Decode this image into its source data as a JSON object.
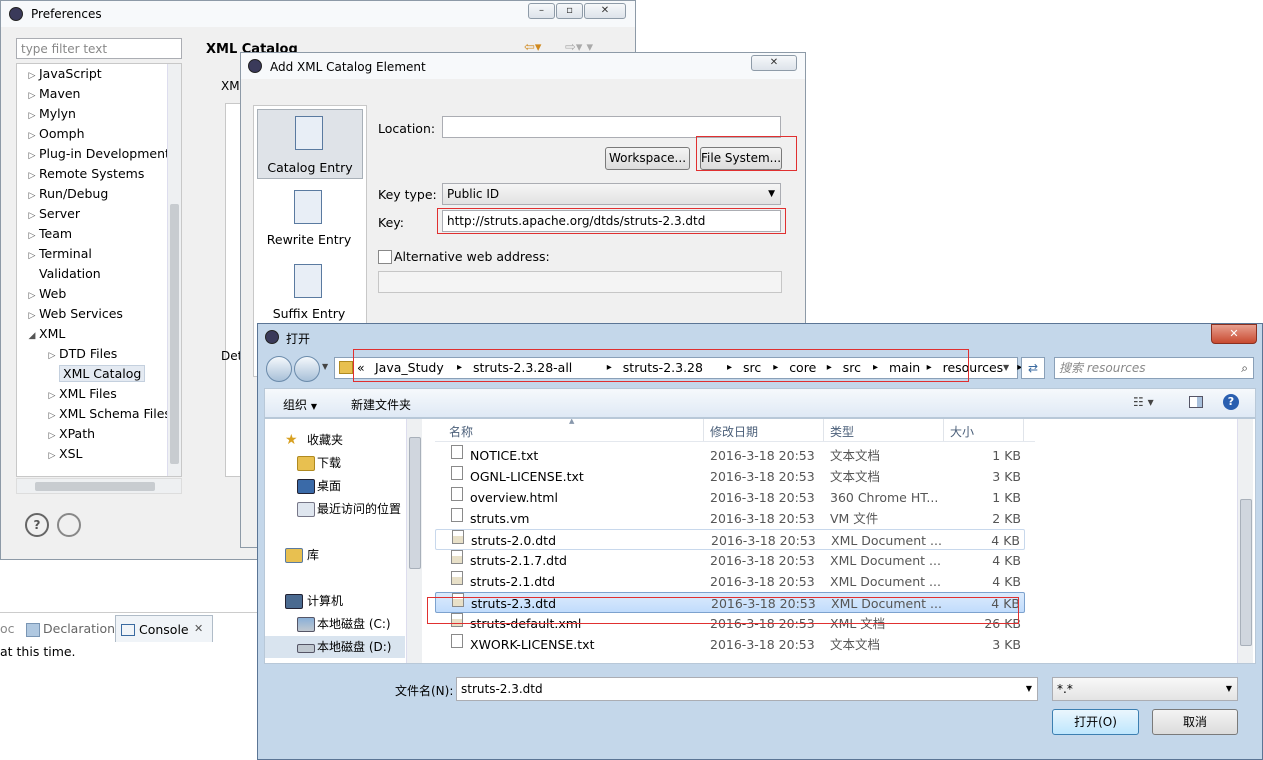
{
  "preferences": {
    "title": "Preferences",
    "filter_placeholder": "type filter text",
    "header_title": "XML Catalog",
    "partial_xm": "XM",
    "partial_det": "Det",
    "tree": [
      {
        "label": "JavaScript",
        "arrow": "▷"
      },
      {
        "label": "Maven",
        "arrow": "▷"
      },
      {
        "label": "Mylyn",
        "arrow": "▷"
      },
      {
        "label": "Oomph",
        "arrow": "▷"
      },
      {
        "label": "Plug-in Development",
        "arrow": "▷"
      },
      {
        "label": "Remote Systems",
        "arrow": "▷"
      },
      {
        "label": "Run/Debug",
        "arrow": "▷"
      },
      {
        "label": "Server",
        "arrow": "▷"
      },
      {
        "label": "Team",
        "arrow": "▷"
      },
      {
        "label": "Terminal",
        "arrow": "▷"
      },
      {
        "label": "Validation",
        "arrow": ""
      },
      {
        "label": "Web",
        "arrow": "▷"
      },
      {
        "label": "Web Services",
        "arrow": "▷"
      },
      {
        "label": "XML",
        "arrow": "◢"
      },
      {
        "label": "DTD Files",
        "arrow": "▷"
      },
      {
        "label": "XML Catalog",
        "arrow": ""
      },
      {
        "label": "XML Files",
        "arrow": "▷"
      },
      {
        "label": "XML Schema Files",
        "arrow": "▷"
      },
      {
        "label": "XPath",
        "arrow": "▷"
      },
      {
        "label": "XSL",
        "arrow": "▷"
      }
    ]
  },
  "console_bar": {
    "partial_left": "oc",
    "declaration_tab": "Declaration",
    "console_tab": "Console",
    "status_text": "at this time."
  },
  "catalog_dialog": {
    "title": "Add XML Catalog Element",
    "side_items": [
      "Catalog Entry",
      "Rewrite Entry",
      "Suffix Entry"
    ],
    "location_label": "Location:",
    "location_value": "",
    "workspace_button": "Workspace...",
    "filesystem_button": "File System...",
    "keytype_label": "Key type:",
    "keytype_value": "Public ID",
    "key_label": "Key:",
    "key_value": "http://struts.apache.org/dtds/struts-2.3.dtd",
    "alt_web_label": "Alternative web address:",
    "alt_web_value": ""
  },
  "open_dialog": {
    "title": "打开",
    "breadcrumb": [
      "«",
      "Java_Study",
      "struts-2.3.28-all",
      "struts-2.3.28",
      "src",
      "core",
      "src",
      "main",
      "resources"
    ],
    "search_placeholder": "搜索 resources",
    "organize": "组织",
    "new_folder": "新建文件夹",
    "nav": {
      "favorites": "收藏夹",
      "downloads": "下载",
      "desktop": "桌面",
      "recent": "最近访问的位置",
      "libraries": "库",
      "computer": "计算机",
      "drive_c": "本地磁盘 (C:)",
      "drive_d": "本地磁盘 (D:)"
    },
    "columns": {
      "name": "名称",
      "date": "修改日期",
      "type": "类型",
      "size": "大小"
    },
    "files": [
      {
        "name": "NOTICE.txt",
        "date": "2016-3-18 20:53",
        "type": "文本文档",
        "size": "1 KB",
        "kind": "txt"
      },
      {
        "name": "OGNL-LICENSE.txt",
        "date": "2016-3-18 20:53",
        "type": "文本文档",
        "size": "3 KB",
        "kind": "txt"
      },
      {
        "name": "overview.html",
        "date": "2016-3-18 20:53",
        "type": "360 Chrome HT...",
        "size": "1 KB",
        "kind": "txt"
      },
      {
        "name": "struts.vm",
        "date": "2016-3-18 20:53",
        "type": "VM 文件",
        "size": "2 KB",
        "kind": "txt"
      },
      {
        "name": "struts-2.0.dtd",
        "date": "2016-3-18 20:53",
        "type": "XML Document ...",
        "size": "4 KB",
        "kind": "xml"
      },
      {
        "name": "struts-2.1.7.dtd",
        "date": "2016-3-18 20:53",
        "type": "XML Document ...",
        "size": "4 KB",
        "kind": "xml"
      },
      {
        "name": "struts-2.1.dtd",
        "date": "2016-3-18 20:53",
        "type": "XML Document ...",
        "size": "4 KB",
        "kind": "xml"
      },
      {
        "name": "struts-2.3.dtd",
        "date": "2016-3-18 20:53",
        "type": "XML Document ...",
        "size": "4 KB",
        "kind": "xml"
      },
      {
        "name": "struts-default.xml",
        "date": "2016-3-18 20:53",
        "type": "XML 文档",
        "size": "26 KB",
        "kind": "xml"
      },
      {
        "name": "XWORK-LICENSE.txt",
        "date": "2016-3-18 20:53",
        "type": "文本文档",
        "size": "3 KB",
        "kind": "txt"
      }
    ],
    "filename_label": "文件名(N):",
    "filename_value": "struts-2.3.dtd",
    "filter_value": "*.*",
    "open_button": "打开(O)",
    "cancel_button": "取消"
  }
}
